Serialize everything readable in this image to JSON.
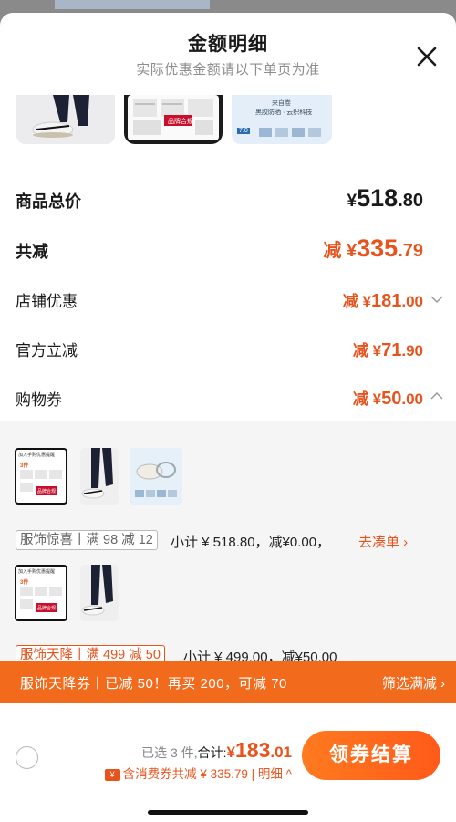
{
  "header": {
    "title": "金额明细",
    "subtitle": "实际优惠金额请以下单页为准"
  },
  "top_thumbs": {
    "thumb2_stamp": "品牌合规",
    "thumb3_label": "来自卷",
    "thumb3_caption": "黑胶防晒 · 云织科技",
    "thumb3_badge": "7.0"
  },
  "breakdown": {
    "total": {
      "label": "商品总价",
      "symbol": "¥",
      "integer": "518",
      "decimal": ".80"
    },
    "discount": {
      "label": "共减",
      "prefix": "减 ¥",
      "integer": "335",
      "decimal": ".79"
    },
    "shop": {
      "label": "店铺优惠",
      "prefix": "减 ¥",
      "integer": "181",
      "decimal": ".00"
    },
    "official": {
      "label": "官方立减",
      "prefix": "减 ¥",
      "integer": "71",
      "decimal": ".90"
    },
    "coupon": {
      "label": "购物券",
      "prefix": "减 ¥",
      "integer": "50",
      "decimal": ".00"
    }
  },
  "coupon_groups": [
    {
      "tag": "服饰惊喜丨满 98 减 12",
      "subtotal": "小计 ¥ 518.80，减¥0.00，",
      "link": "去凑单 ›"
    },
    {
      "tag": "服饰天降丨满 499 减 50",
      "subtotal": "小计 ¥ 499.00，减¥50.00",
      "link": ""
    }
  ],
  "group_thumb_text": {
    "flyer_header": "加入手购优惠提醒",
    "flyer_badge": "3件",
    "flyer_stamp": "品牌合规"
  },
  "banner": {
    "text": "服饰天降券丨已减 50！再买 200，可减 70",
    "filter": "筛选满减 ›"
  },
  "footer": {
    "selected": "已选 3 件,",
    "total_label": "合计:",
    "total_symbol": "¥",
    "total_integer": "183",
    "total_decimal": ".01",
    "coupon_icon_text": "¥",
    "summary": "含消费券共减 ¥ 335.79 | 明细 ^",
    "checkout": "领券结算"
  },
  "colors": {
    "accent": "#e8531c",
    "banner": "#f26b1d",
    "button_start": "#ff7a1f",
    "button_end": "#ff5a1a"
  }
}
